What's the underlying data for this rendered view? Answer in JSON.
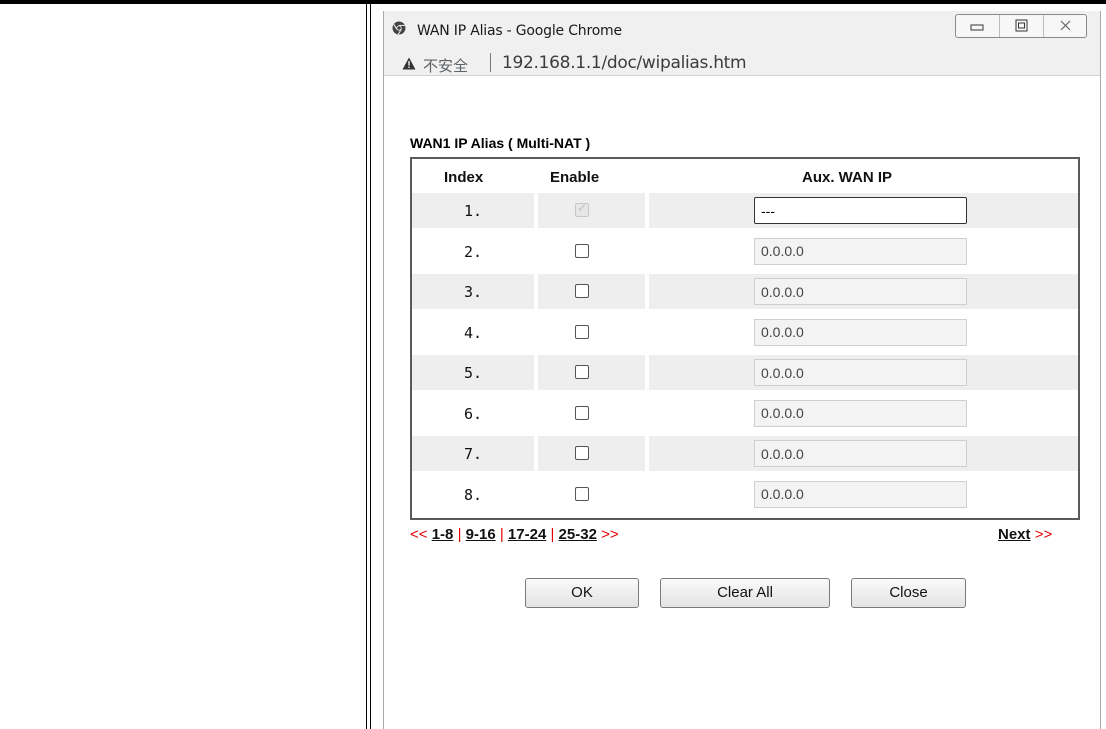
{
  "window": {
    "title": "WAN IP Alias - Google Chrome"
  },
  "address": {
    "security_label": "不安全",
    "url": "192.168.1.1/doc/wipalias.htm"
  },
  "page": {
    "section_title": "WAN1  IP Alias ( Multi-NAT )",
    "columns": {
      "index": "Index",
      "enable": "Enable",
      "aux_wan_ip": "Aux. WAN IP"
    },
    "rows": [
      {
        "index": "1.",
        "enabled": true,
        "disabled": true,
        "ip": "---"
      },
      {
        "index": "2.",
        "enabled": false,
        "disabled": false,
        "ip": "0.0.0.0"
      },
      {
        "index": "3.",
        "enabled": false,
        "disabled": false,
        "ip": "0.0.0.0"
      },
      {
        "index": "4.",
        "enabled": false,
        "disabled": false,
        "ip": "0.0.0.0"
      },
      {
        "index": "5.",
        "enabled": false,
        "disabled": false,
        "ip": "0.0.0.0"
      },
      {
        "index": "6.",
        "enabled": false,
        "disabled": false,
        "ip": "0.0.0.0"
      },
      {
        "index": "7.",
        "enabled": false,
        "disabled": false,
        "ip": "0.0.0.0"
      },
      {
        "index": "8.",
        "enabled": false,
        "disabled": false,
        "ip": "0.0.0.0"
      }
    ],
    "pager": {
      "prev_arrow": "<<",
      "pages": [
        "1-8",
        "9-16",
        "17-24",
        "25-32"
      ],
      "next_arrow": ">>",
      "next_label": "Next"
    },
    "buttons": {
      "ok": "OK",
      "clear_all": "Clear All",
      "close": "Close"
    }
  },
  "icons": {
    "browser": "chrome-icon",
    "warning": "warning-icon",
    "minimize": "minimize-icon",
    "maximize": "maximize-icon",
    "close": "close-window-icon"
  },
  "colors": {
    "pager_accent": "#e60000",
    "row_shade": "#eeeeee",
    "table_border": "#5a5a5a"
  }
}
